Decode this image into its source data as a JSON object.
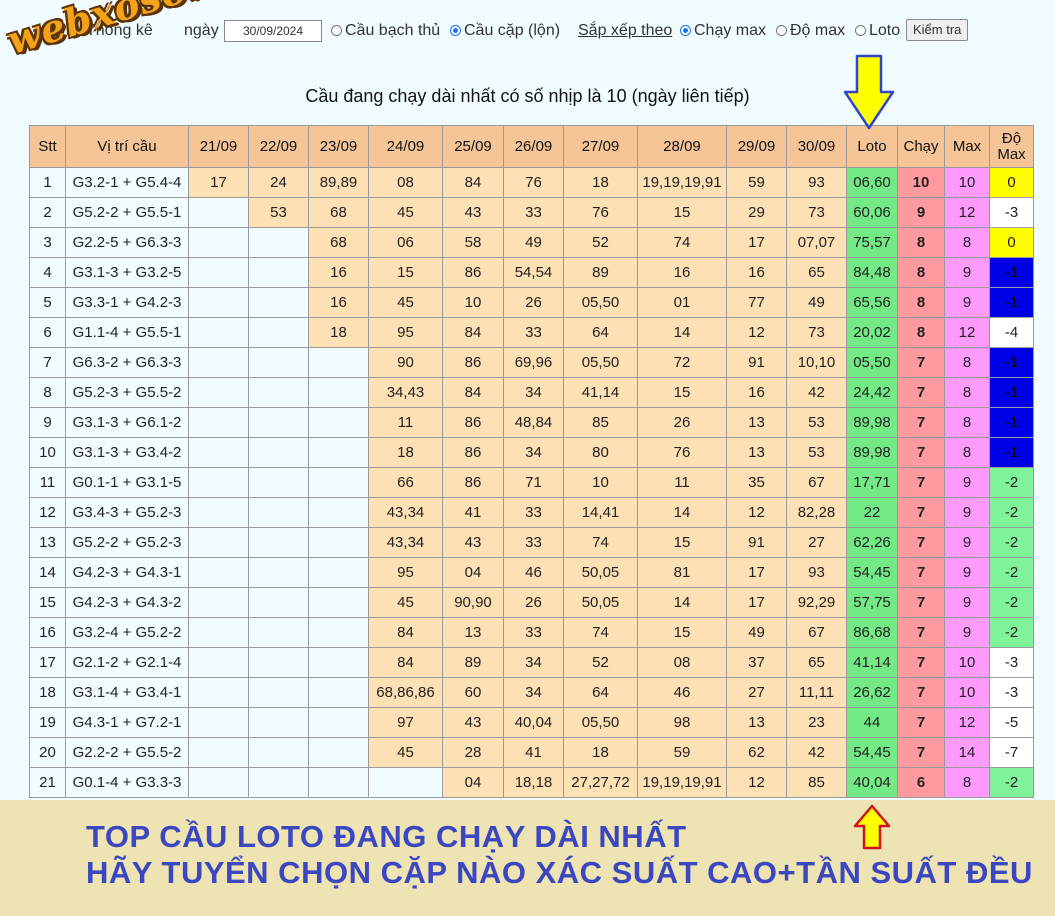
{
  "form": {
    "stat_label": "Thống kê",
    "day_label": "ngày",
    "date_value": "30/09/2024",
    "option_single": "Cầu bạch thủ",
    "option_pair": "Cầu cặp (lộn)",
    "sort_label": "Sắp xếp theo",
    "sort_run": "Chạy max",
    "sort_dev": "Độ max",
    "sort_loto": "Loto",
    "check_button": "Kiểm tra"
  },
  "logo": {
    "text": "webxoso.net",
    "color": "#f3a21a"
  },
  "heading": "Cầu đang chạy dài nhất có số nhịp là 10 (ngày liên tiếp)",
  "table": {
    "headers": {
      "stt": "Stt",
      "position": "Vị trí cầu",
      "dates": [
        "21/09",
        "22/09",
        "23/09",
        "24/09",
        "25/09",
        "26/09",
        "27/09",
        "28/09",
        "29/09",
        "30/09"
      ],
      "loto": "Loto",
      "run": "Chạy",
      "max": "Max",
      "dev_max_1": "Độ",
      "dev_max_2": "Max"
    },
    "rows": [
      {
        "stt": "1",
        "pos": "G3.2-1 + G5.4-4",
        "days": [
          "17",
          "24",
          "89,89",
          "08",
          "84",
          "76",
          "18",
          "19,19,19,91",
          "59",
          "93"
        ],
        "loto": "06,60",
        "run": "10",
        "max": "10",
        "dev": "0",
        "dev_color": "yellow"
      },
      {
        "stt": "2",
        "pos": "G5.2-2 + G5.5-1",
        "days": [
          "",
          "53",
          "68",
          "45",
          "43",
          "33",
          "76",
          "15",
          "29",
          "73"
        ],
        "loto": "60,06",
        "run": "9",
        "max": "12",
        "dev": "-3",
        "dev_color": "white"
      },
      {
        "stt": "3",
        "pos": "G2.2-5 + G6.3-3",
        "days": [
          "",
          "",
          "68",
          "06",
          "58",
          "49",
          "52",
          "74",
          "17",
          "07,07"
        ],
        "loto": "75,57",
        "run": "8",
        "max": "8",
        "dev": "0",
        "dev_color": "yellow"
      },
      {
        "stt": "4",
        "pos": "G3.1-3 + G3.2-5",
        "days": [
          "",
          "",
          "16",
          "15",
          "86",
          "54,54",
          "89",
          "16",
          "16",
          "65"
        ],
        "loto": "84,48",
        "run": "8",
        "max": "9",
        "dev": "-1",
        "dev_color": "blue"
      },
      {
        "stt": "5",
        "pos": "G3.3-1 + G4.2-3",
        "days": [
          "",
          "",
          "16",
          "45",
          "10",
          "26",
          "05,50",
          "01",
          "77",
          "49"
        ],
        "loto": "65,56",
        "run": "8",
        "max": "9",
        "dev": "-1",
        "dev_color": "blue"
      },
      {
        "stt": "6",
        "pos": "G1.1-4 + G5.5-1",
        "days": [
          "",
          "",
          "18",
          "95",
          "84",
          "33",
          "64",
          "14",
          "12",
          "73"
        ],
        "loto": "20,02",
        "run": "8",
        "max": "12",
        "dev": "-4",
        "dev_color": "white"
      },
      {
        "stt": "7",
        "pos": "G6.3-2 + G6.3-3",
        "days": [
          "",
          "",
          "",
          "90",
          "86",
          "69,96",
          "05,50",
          "72",
          "91",
          "10,10"
        ],
        "loto": "05,50",
        "run": "7",
        "max": "8",
        "dev": "-1",
        "dev_color": "blue"
      },
      {
        "stt": "8",
        "pos": "G5.2-3 + G5.5-2",
        "days": [
          "",
          "",
          "",
          "34,43",
          "84",
          "34",
          "41,14",
          "15",
          "16",
          "42"
        ],
        "loto": "24,42",
        "run": "7",
        "max": "8",
        "dev": "-1",
        "dev_color": "blue"
      },
      {
        "stt": "9",
        "pos": "G3.1-3 + G6.1-2",
        "days": [
          "",
          "",
          "",
          "11",
          "86",
          "48,84",
          "85",
          "26",
          "13",
          "53"
        ],
        "loto": "89,98",
        "run": "7",
        "max": "8",
        "dev": "-1",
        "dev_color": "blue"
      },
      {
        "stt": "10",
        "pos": "G3.1-3 + G3.4-2",
        "days": [
          "",
          "",
          "",
          "18",
          "86",
          "34",
          "80",
          "76",
          "13",
          "53"
        ],
        "loto": "89,98",
        "run": "7",
        "max": "8",
        "dev": "-1",
        "dev_color": "blue"
      },
      {
        "stt": "11",
        "pos": "G0.1-1 + G3.1-5",
        "days": [
          "",
          "",
          "",
          "66",
          "86",
          "71",
          "10",
          "11",
          "35",
          "67"
        ],
        "loto": "17,71",
        "run": "7",
        "max": "9",
        "dev": "-2",
        "dev_color": "green"
      },
      {
        "stt": "12",
        "pos": "G3.4-3 + G5.2-3",
        "days": [
          "",
          "",
          "",
          "43,34",
          "41",
          "33",
          "14,41",
          "14",
          "12",
          "82,28"
        ],
        "loto": "22",
        "run": "7",
        "max": "9",
        "dev": "-2",
        "dev_color": "green"
      },
      {
        "stt": "13",
        "pos": "G5.2-2 + G5.2-3",
        "days": [
          "",
          "",
          "",
          "43,34",
          "43",
          "33",
          "74",
          "15",
          "91",
          "27"
        ],
        "loto": "62,26",
        "run": "7",
        "max": "9",
        "dev": "-2",
        "dev_color": "green"
      },
      {
        "stt": "14",
        "pos": "G4.2-3 + G4.3-1",
        "days": [
          "",
          "",
          "",
          "95",
          "04",
          "46",
          "50,05",
          "81",
          "17",
          "93"
        ],
        "loto": "54,45",
        "run": "7",
        "max": "9",
        "dev": "-2",
        "dev_color": "green"
      },
      {
        "stt": "15",
        "pos": "G4.2-3 + G4.3-2",
        "days": [
          "",
          "",
          "",
          "45",
          "90,90",
          "26",
          "50,05",
          "14",
          "17",
          "92,29"
        ],
        "loto": "57,75",
        "run": "7",
        "max": "9",
        "dev": "-2",
        "dev_color": "green"
      },
      {
        "stt": "16",
        "pos": "G3.2-4 + G5.2-2",
        "days": [
          "",
          "",
          "",
          "84",
          "13",
          "33",
          "74",
          "15",
          "49",
          "67"
        ],
        "loto": "86,68",
        "run": "7",
        "max": "9",
        "dev": "-2",
        "dev_color": "green"
      },
      {
        "stt": "17",
        "pos": "G2.1-2 + G2.1-4",
        "days": [
          "",
          "",
          "",
          "84",
          "89",
          "34",
          "52",
          "08",
          "37",
          "65"
        ],
        "loto": "41,14",
        "run": "7",
        "max": "10",
        "dev": "-3",
        "dev_color": "white"
      },
      {
        "stt": "18",
        "pos": "G3.1-4 + G3.4-1",
        "days": [
          "",
          "",
          "",
          "68,86,86",
          "60",
          "34",
          "64",
          "46",
          "27",
          "11,11"
        ],
        "loto": "26,62",
        "run": "7",
        "max": "10",
        "dev": "-3",
        "dev_color": "white"
      },
      {
        "stt": "19",
        "pos": "G4.3-1 + G7.2-1",
        "days": [
          "",
          "",
          "",
          "97",
          "43",
          "40,04",
          "05,50",
          "98",
          "13",
          "23"
        ],
        "loto": "44",
        "run": "7",
        "max": "12",
        "dev": "-5",
        "dev_color": "white"
      },
      {
        "stt": "20",
        "pos": "G2.2-2 + G5.5-2",
        "days": [
          "",
          "",
          "",
          "45",
          "28",
          "41",
          "18",
          "59",
          "62",
          "42"
        ],
        "loto": "54,45",
        "run": "7",
        "max": "14",
        "dev": "-7",
        "dev_color": "white"
      },
      {
        "stt": "21",
        "pos": "G0.1-4 + G3.3-3",
        "days": [
          "",
          "",
          "",
          "",
          "04",
          "18,18",
          "27,27,72",
          "19,19,19,91",
          "12",
          "85"
        ],
        "loto": "40,04",
        "run": "6",
        "max": "8",
        "dev": "-2",
        "dev_color": "green"
      }
    ]
  },
  "banner": {
    "line1": "TOP CẦU LOTO ĐANG CHẠY DÀI NHẤT",
    "line2": "HÃY TUYỂN CHỌN CẶP NÀO XÁC SUẤT CAO+TẦN SUẤT ĐỀU"
  },
  "colors": {
    "header_bg": "#f6c597",
    "day_cell_bg": "#fde0b4",
    "loto_bg": "#73ea86",
    "run_bg": "#ff9aa1",
    "max_bg": "#ff9aff",
    "arrow_yellow": "#ffff00",
    "arrow_outline": "#3344cc",
    "banner_bg": "#ede3b3",
    "banner_text": "#3b47c0"
  },
  "icons": [
    "down-arrow-icon",
    "up-arrow-icon",
    "radio-icon"
  ]
}
